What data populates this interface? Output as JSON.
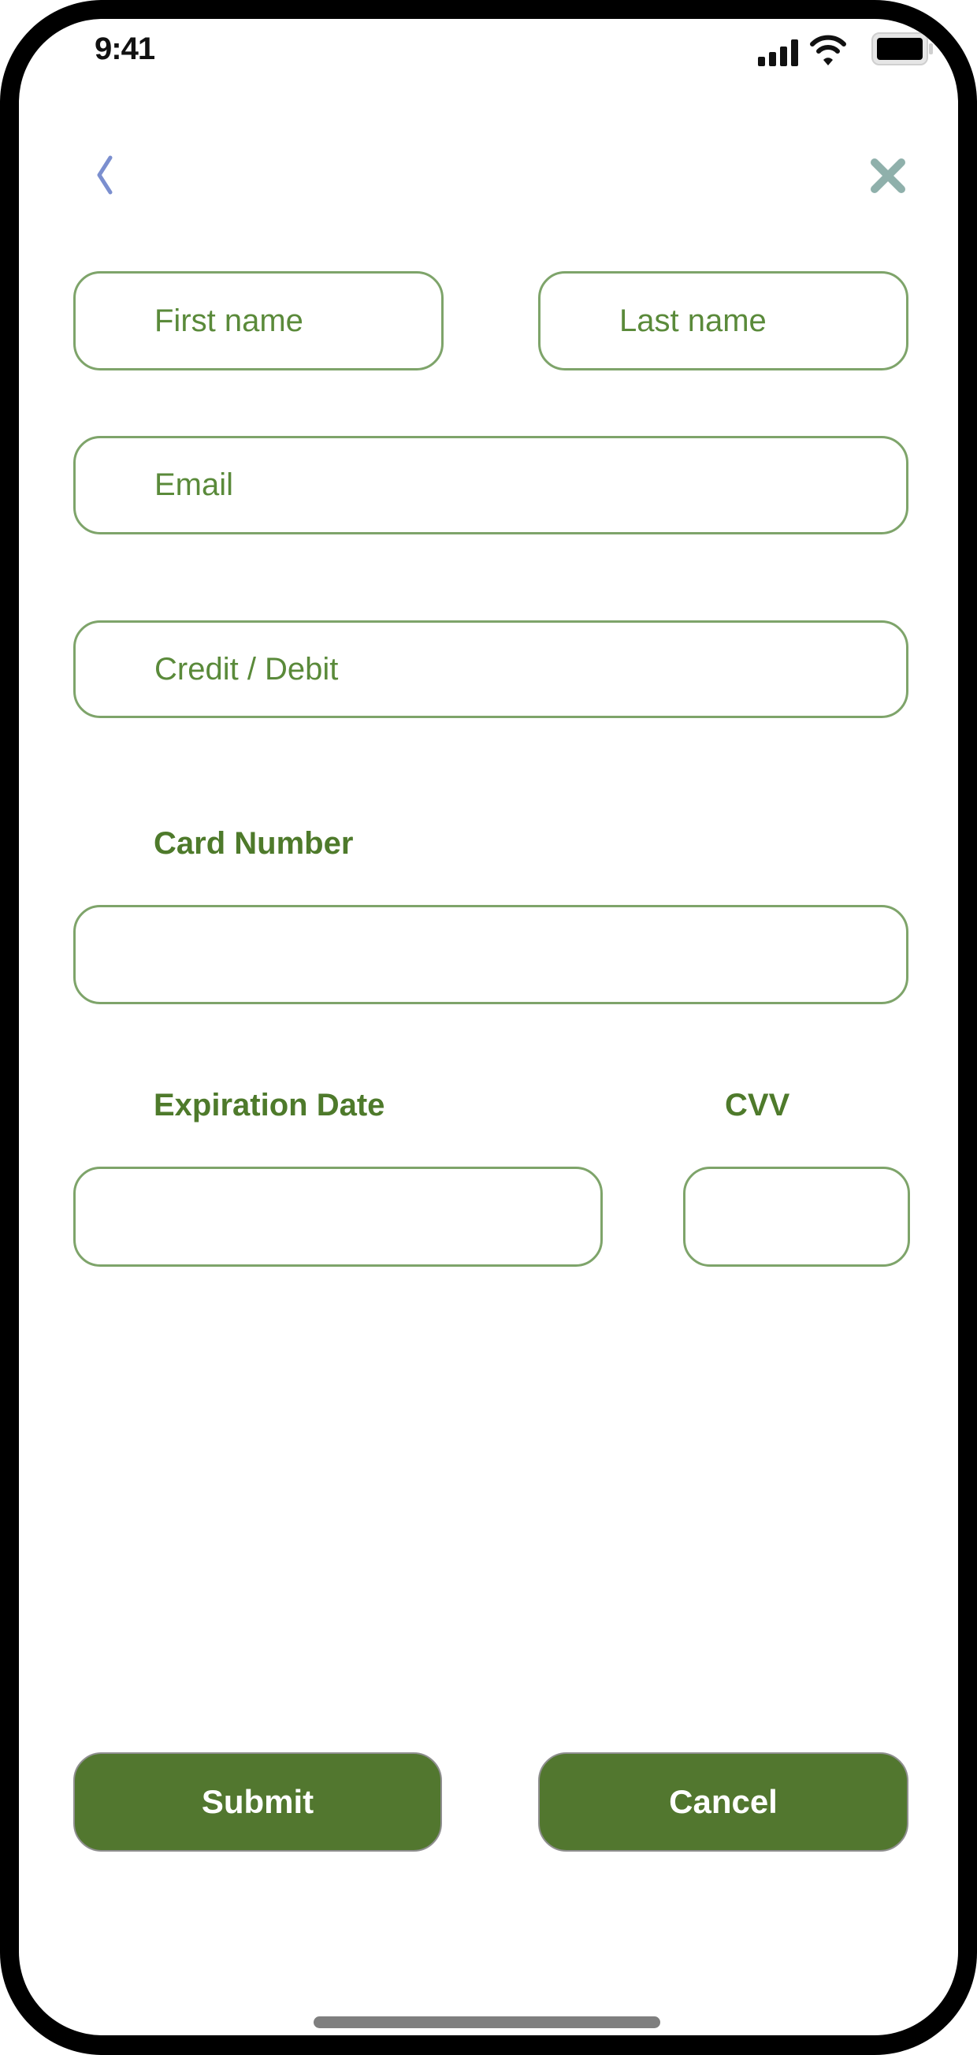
{
  "status_bar": {
    "time": "9:41",
    "icons": [
      "signal-icon",
      "wifi-icon",
      "battery-icon"
    ]
  },
  "header": {
    "back_icon": "chevron-left-icon",
    "close_icon": "close-icon"
  },
  "form": {
    "first_name": {
      "placeholder": "First name",
      "value": ""
    },
    "last_name": {
      "placeholder": "Last name",
      "value": ""
    },
    "email": {
      "placeholder": "Email",
      "value": ""
    },
    "payment_type": {
      "placeholder": "Credit / Debit",
      "value": ""
    },
    "card_number": {
      "label": "Card Number",
      "value": ""
    },
    "expiration_date": {
      "label": "Expiration Date",
      "value": ""
    },
    "cvv": {
      "label": "CVV",
      "value": ""
    }
  },
  "actions": {
    "submit_label": "Submit",
    "cancel_label": "Cancel"
  },
  "colors": {
    "accent": "#52772f",
    "field_border": "#7ea46a",
    "field_text": "#5a8a3a",
    "label_text": "#4e7a2b",
    "back_icon": "#7b8fcf",
    "close_icon": "#8fb0ab"
  }
}
